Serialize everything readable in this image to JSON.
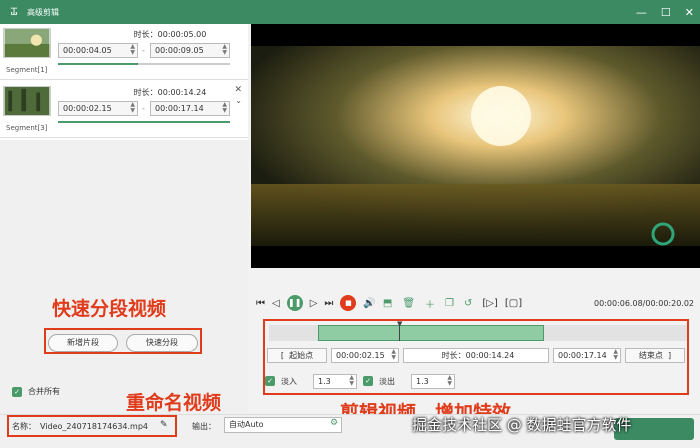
{
  "window": {
    "title": "高级剪辑",
    "logo": "ꯊ",
    "minimize": "—",
    "maximize": "☐",
    "close": "✕"
  },
  "segments": [
    {
      "name": "Segment[1]",
      "duration": "时长：00:00:05.00",
      "start": "00:00:04.05",
      "end": "00:00:09.05"
    },
    {
      "name": "Segment[3]",
      "duration": "时长：00:00:14.24",
      "start": "00:00:02.15",
      "end": "00:00:17.14"
    }
  ],
  "left_buttons": {
    "add_segment": "新增片段",
    "quick_segment": "快速分段",
    "merge_all": "合并所有"
  },
  "annotations": {
    "quick_split": "快速分段视频",
    "rename": "重命名视频",
    "edit": "剪辑视频，增加特效"
  },
  "player": {
    "time": "00:00:06.08/00:00:20.02"
  },
  "trim": {
    "start_label": "起始点",
    "start_value": "00:00:02.15",
    "duration": "时长：00:00:14.24",
    "end_value": "00:00:17.14",
    "end_label": "结束点",
    "fade_in_label": "淡入",
    "fade_in_value": "1.3",
    "fade_out_label": "淡出",
    "fade_out_value": "1.3"
  },
  "output": {
    "name_label": "名称：",
    "name_value": "Video_240718174634.mp4",
    "output_label": "输出：",
    "output_value": "自动Auto"
  },
  "watermark": "掘金技术社区 @ 数据蛙官方软件",
  "colors": {
    "accent": "#3b8a62",
    "highlight": "#e03b1a"
  }
}
